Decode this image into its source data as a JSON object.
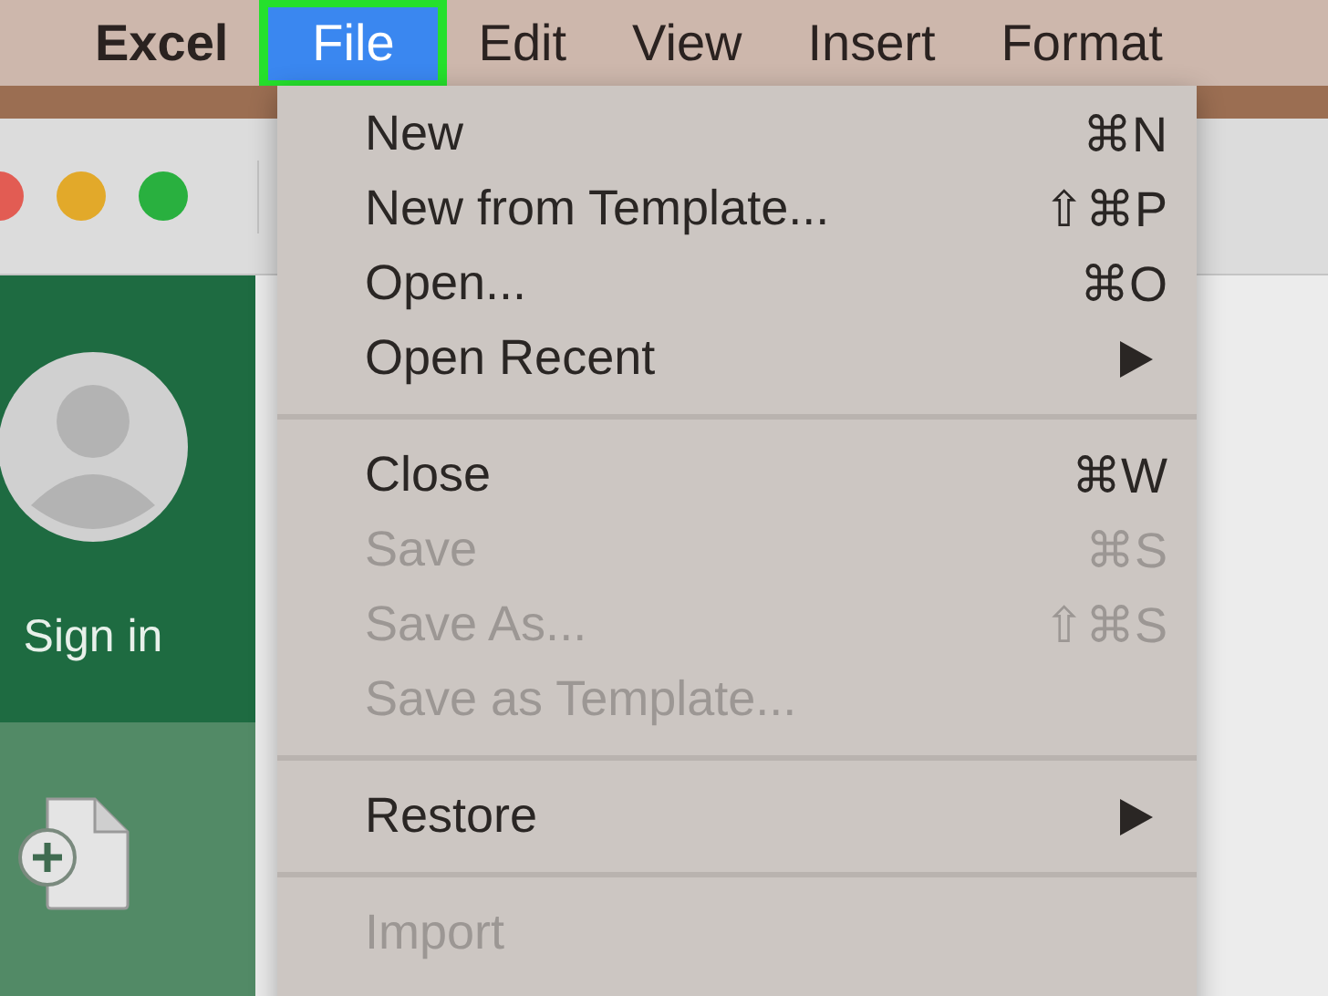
{
  "menu_bar": {
    "app_name": "Excel",
    "menus": [
      {
        "label": "File",
        "selected": true,
        "highlighted": true
      },
      {
        "label": "Edit",
        "selected": false,
        "highlighted": false
      },
      {
        "label": "View",
        "selected": false,
        "highlighted": false
      },
      {
        "label": "Insert",
        "selected": false,
        "highlighted": false
      },
      {
        "label": "Format",
        "selected": false,
        "highlighted": false
      }
    ]
  },
  "file_menu": {
    "items": [
      {
        "kind": "item",
        "label": "New",
        "shortcut": "⌘N",
        "disabled": false,
        "submenu": false
      },
      {
        "kind": "item",
        "label": "New from Template...",
        "shortcut": "⇧⌘P",
        "disabled": false,
        "submenu": false
      },
      {
        "kind": "item",
        "label": "Open...",
        "shortcut": "⌘O",
        "disabled": false,
        "submenu": false
      },
      {
        "kind": "item",
        "label": "Open Recent",
        "disabled": false,
        "submenu": true
      },
      {
        "kind": "separator"
      },
      {
        "kind": "item",
        "label": "Close",
        "shortcut": "⌘W",
        "disabled": false,
        "submenu": false
      },
      {
        "kind": "item",
        "label": "Save",
        "shortcut": "⌘S",
        "disabled": true,
        "submenu": false
      },
      {
        "kind": "item",
        "label": "Save As...",
        "shortcut": "⇧⌘S",
        "disabled": true,
        "submenu": false
      },
      {
        "kind": "item",
        "label": "Save as Template...",
        "disabled": true,
        "submenu": false
      },
      {
        "kind": "separator"
      },
      {
        "kind": "item",
        "label": "Restore",
        "disabled": false,
        "submenu": true
      },
      {
        "kind": "separator"
      },
      {
        "kind": "item",
        "label": "Import",
        "disabled": true,
        "submenu": false
      }
    ]
  },
  "sidebar": {
    "sign_in": "Sign in"
  }
}
